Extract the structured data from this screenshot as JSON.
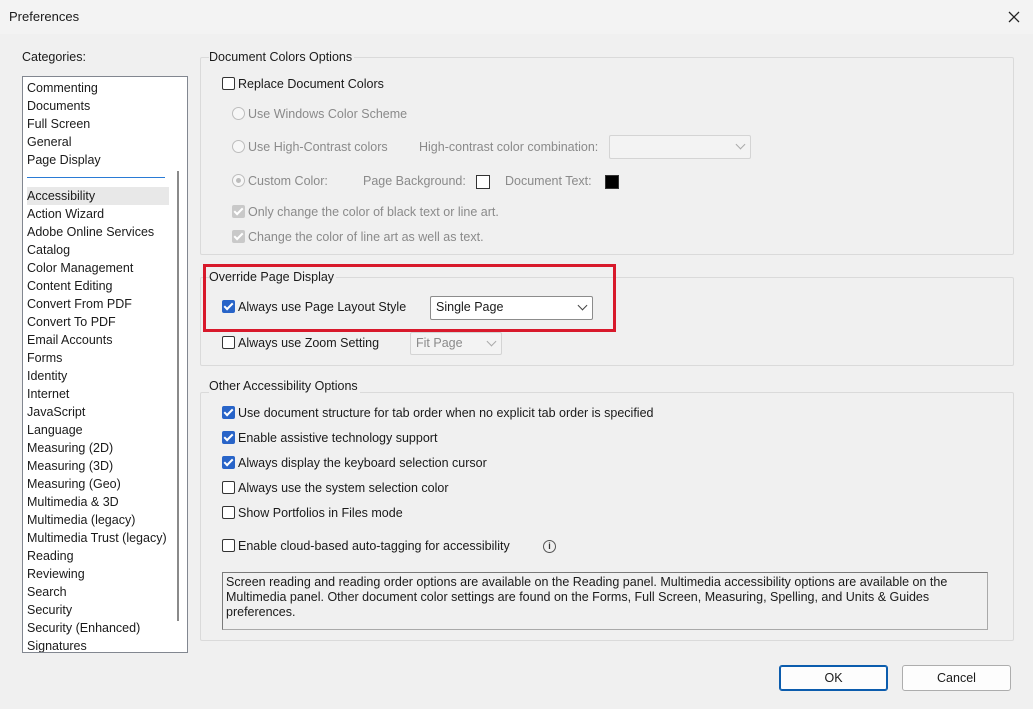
{
  "window": {
    "title": "Preferences"
  },
  "categories": {
    "label": "Categories:",
    "top_items": [
      "Commenting",
      "Documents",
      "Full Screen",
      "General",
      "Page Display"
    ],
    "items": [
      "Accessibility",
      "Action Wizard",
      "Adobe Online Services",
      "Catalog",
      "Color Management",
      "Content Editing",
      "Convert From PDF",
      "Convert To PDF",
      "Email Accounts",
      "Forms",
      "Identity",
      "Internet",
      "JavaScript",
      "Language",
      "Measuring (2D)",
      "Measuring (3D)",
      "Measuring (Geo)",
      "Multimedia & 3D",
      "Multimedia (legacy)",
      "Multimedia Trust (legacy)",
      "Reading",
      "Reviewing",
      "Search",
      "Security",
      "Security (Enhanced)",
      "Signatures"
    ],
    "selected": "Accessibility"
  },
  "doc_colors": {
    "legend": "Document Colors Options",
    "replace": {
      "label": "Replace Document Colors",
      "checked": false
    },
    "windows_scheme": {
      "label": "Use Windows Color Scheme",
      "checked": false
    },
    "high_contrast": {
      "label": "Use High-Contrast colors",
      "checked": false
    },
    "hc_combination_label": "High-contrast color combination:",
    "hc_combination_value": "",
    "custom_color": {
      "label": "Custom Color:",
      "checked": true
    },
    "page_background_label": "Page Background:",
    "document_text_label": "Document Text:",
    "only_black": {
      "label": "Only change the color of black text or line art.",
      "checked": true
    },
    "line_art": {
      "label": "Change the color of line art as well as text.",
      "checked": true
    }
  },
  "override": {
    "legend": "Override Page Display",
    "layout": {
      "label": "Always use Page Layout Style",
      "checked": true,
      "value": "Single Page"
    },
    "zoom": {
      "label": "Always use Zoom Setting",
      "checked": false,
      "value": "Fit Page"
    }
  },
  "other": {
    "legend": "Other Accessibility Options",
    "options": [
      {
        "label": "Use document structure for tab order when no explicit tab order is specified",
        "checked": true
      },
      {
        "label": "Enable assistive technology support",
        "checked": true
      },
      {
        "label": "Always display the keyboard selection cursor",
        "checked": true
      },
      {
        "label": "Always use the system selection color",
        "checked": false
      },
      {
        "label": "Show Portfolios in Files mode",
        "checked": false
      }
    ],
    "cloud": {
      "label": "Enable cloud-based auto-tagging for accessibility",
      "checked": false
    },
    "info_glyph": "i",
    "note": "Screen reading and reading order options are available on the Reading panel. Multimedia accessibility options are available on the Multimedia panel. Other document color settings are found on the Forms, Full Screen, Measuring, Spelling, and Units & Guides preferences."
  },
  "buttons": {
    "ok": "OK",
    "cancel": "Cancel"
  },
  "colors": {
    "accent": "#2864c8",
    "highlight": "#d8192b",
    "page_background_swatch": "#ffffff",
    "document_text_swatch": "#000000"
  }
}
